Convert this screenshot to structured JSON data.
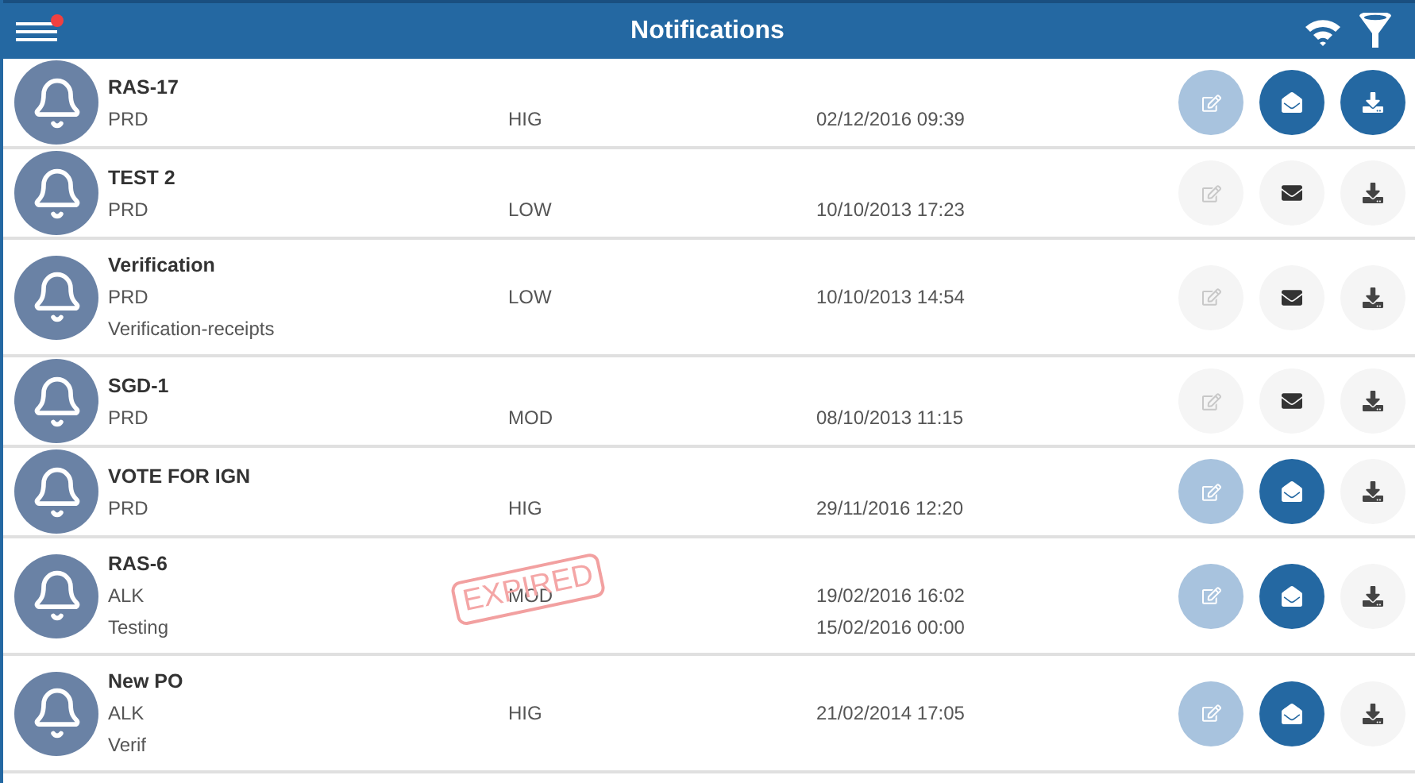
{
  "header": {
    "title": "Notifications",
    "menu_badge": true
  },
  "notifications": [
    {
      "title": "RAS-17",
      "code": "PRD",
      "priority": "HIG",
      "date": "02/12/2016 09:39",
      "editable": true,
      "read": true,
      "downloaded": true,
      "expired": false
    },
    {
      "title": "TEST 2",
      "code": "PRD",
      "priority": "LOW",
      "date": "10/10/2013 17:23",
      "editable": false,
      "read": false,
      "downloaded": false,
      "expired": false
    },
    {
      "title": "Verification",
      "code": "PRD",
      "priority": "LOW",
      "date": "10/10/2013 14:54",
      "note": "Verification-receipts",
      "editable": false,
      "read": false,
      "downloaded": false,
      "expired": false
    },
    {
      "title": "SGD-1",
      "code": "PRD",
      "priority": "MOD",
      "date": "08/10/2013 11:15",
      "editable": false,
      "read": false,
      "downloaded": false,
      "expired": false
    },
    {
      "title": "VOTE FOR IGN",
      "code": "PRD",
      "priority": "HIG",
      "date": "29/11/2016 12:20",
      "editable": true,
      "read": true,
      "downloaded": false,
      "expired": false
    },
    {
      "title": "RAS-6",
      "code": "ALK",
      "priority": "MOD",
      "date": "19/02/2016 16:02",
      "note": "Testing",
      "date_2": "15/02/2016 00:00",
      "editable": true,
      "read": true,
      "downloaded": false,
      "expired": true,
      "stamp": "EXPIRED"
    },
    {
      "title": "New PO",
      "code": "ALK",
      "priority": "HIG",
      "date": "21/02/2014 17:05",
      "note": "Verif",
      "editable": true,
      "read": true,
      "downloaded": false,
      "expired": false
    }
  ]
}
